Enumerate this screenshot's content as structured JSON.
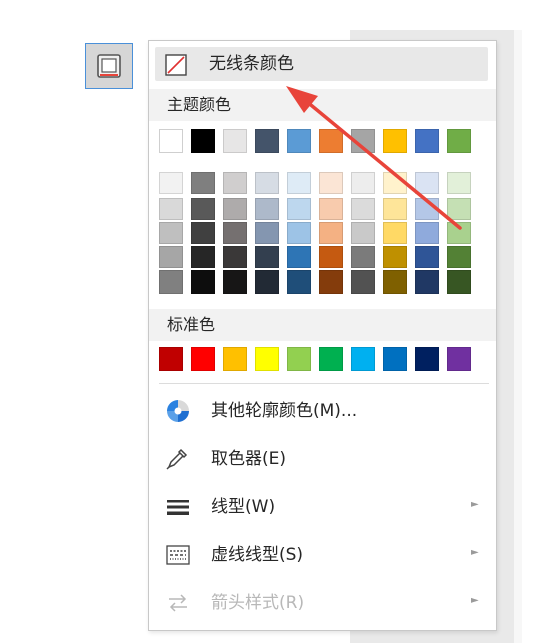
{
  "menu": {
    "no_color_label": "无线条颜色",
    "theme_colors_label": "主题颜色",
    "standard_colors_label": "标准色",
    "more_colors_label": "其他轮廓颜色(M)...",
    "eyedropper_label": "取色器(E)",
    "line_style_label": "线型(W)",
    "dash_style_label": "虚线线型(S)",
    "arrow_style_label": "箭头样式(R)",
    "submenu_arrow": "►"
  },
  "theme_colors": [
    [
      "#ffffff",
      "#f2f2f2",
      "#d9d9d9",
      "#bfbfbf",
      "#a6a6a6",
      "#808080"
    ],
    [
      "#000000",
      "#7f7f7f",
      "#595959",
      "#404040",
      "#262626",
      "#0d0d0d"
    ],
    [
      "#e7e6e6",
      "#d0cece",
      "#aeabab",
      "#757070",
      "#3a3838",
      "#171616"
    ],
    [
      "#44546a",
      "#d6dce4",
      "#adb9ca",
      "#8496b0",
      "#333f4f",
      "#222a35"
    ],
    [
      "#5b9bd5",
      "#deebf6",
      "#bdd7ee",
      "#9dc3e6",
      "#2e75b5",
      "#1f4e79"
    ],
    [
      "#ed7d31",
      "#fbe5d5",
      "#f8cbad",
      "#f4b183",
      "#c55a11",
      "#843c0c"
    ],
    [
      "#a5a5a5",
      "#ededed",
      "#dbdbdb",
      "#c9c9c9",
      "#7b7b7b",
      "#525252"
    ],
    [
      "#ffc000",
      "#fff2cc",
      "#fee599",
      "#ffd965",
      "#bf9000",
      "#7f6000"
    ],
    [
      "#4472c4",
      "#dae3f3",
      "#b4c7e7",
      "#8faadc",
      "#2f5597",
      "#203864"
    ],
    [
      "#70ad47",
      "#e2f0d9",
      "#c5e0b4",
      "#a9d18e",
      "#538135",
      "#375623"
    ]
  ],
  "standard_colors": [
    "#c00000",
    "#ff0000",
    "#ffc000",
    "#ffff00",
    "#92d050",
    "#00b050",
    "#00b0f0",
    "#0070c0",
    "#002060",
    "#7030a0"
  ],
  "colors": {
    "pointer_arrow": "#e8443a",
    "icon_gray": "#555555"
  },
  "icons": {
    "trigger": "shape-outline-icon",
    "no_color": "no-color-slash-icon",
    "more_colors": "color-wheel-icon",
    "eyedropper": "eyedropper-icon",
    "line_style": "line-weight-icon",
    "dash_style": "dash-style-icon",
    "arrow_style": "arrow-style-icon"
  }
}
